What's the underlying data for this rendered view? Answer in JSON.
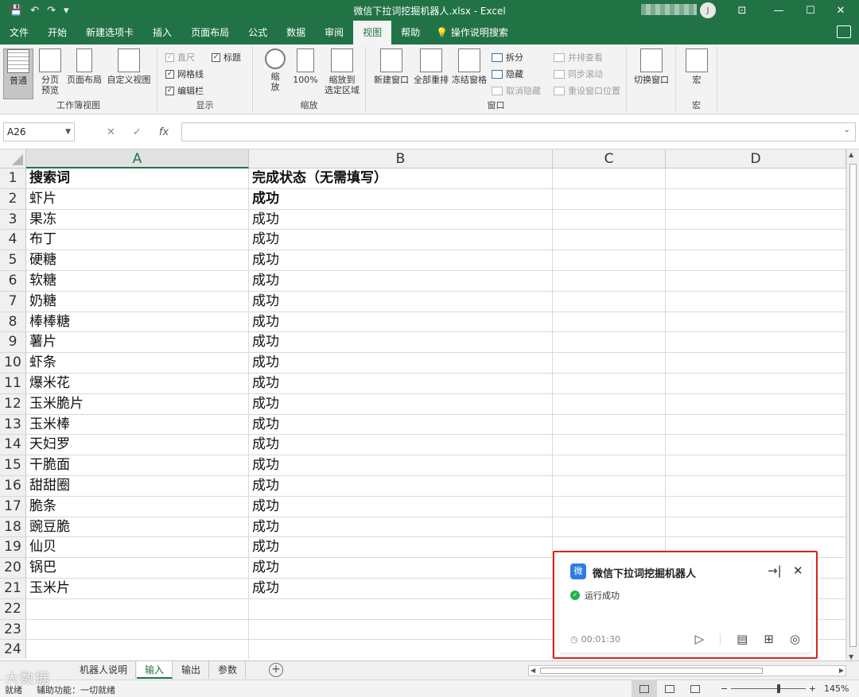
{
  "window": {
    "title": "微信下拉词挖掘机器人.xlsx  -  Excel",
    "user_initial": "J",
    "qa_save": "💾",
    "qa_undo": "↶",
    "qa_redo": "↷",
    "qa_more": "▾",
    "ribbon_display": "⊡",
    "minimize": "—",
    "maximize": "☐",
    "close": "✕"
  },
  "tabs": [
    {
      "label": "文件"
    },
    {
      "label": "开始"
    },
    {
      "label": "新建选项卡"
    },
    {
      "label": "插入"
    },
    {
      "label": "页面布局"
    },
    {
      "label": "公式"
    },
    {
      "label": "数据"
    },
    {
      "label": "审阅"
    },
    {
      "label": "视图"
    },
    {
      "label": "帮助"
    }
  ],
  "tell_me": "操作说明搜索",
  "ribbon": {
    "groups": {
      "workbook_views": "工作簿视图",
      "show": "显示",
      "zoom": "缩放",
      "window": "窗口",
      "macros": "宏"
    },
    "normal": "普通",
    "page_break": "分页\n预览",
    "page_layout": "页面布局",
    "custom_views": "自定义视图",
    "ruler": "直尺",
    "gridlines": "网格线",
    "formula_bar": "编辑栏",
    "headings": "标题",
    "check_mark": "✓",
    "zoom": "缩\n放",
    "zoom_100": "100%",
    "zoom_selection": "缩放到\n选定区域",
    "new_window": "新建窗口",
    "arrange_all": "全部重排",
    "freeze_panes": "冻结窗格",
    "split": "拆分",
    "hide": "隐藏",
    "unhide": "取消隐藏",
    "side_by_side": "并排查看",
    "sync_scroll": "同步滚动",
    "reset_pos": "重设窗口位置",
    "switch_windows": "切换窗口",
    "macros": "宏"
  },
  "formula_bar": {
    "name_box": "A26",
    "cancel": "✕",
    "enter": "✓",
    "fx": "fx",
    "value": ""
  },
  "columns": [
    "A",
    "B",
    "C",
    "D"
  ],
  "rows": [
    {
      "n": "1",
      "a": "搜索词",
      "b": "完成状态（无需填写）"
    },
    {
      "n": "2",
      "a": "虾片",
      "b": "成功"
    },
    {
      "n": "3",
      "a": "果冻",
      "b": "成功"
    },
    {
      "n": "4",
      "a": "布丁",
      "b": "成功"
    },
    {
      "n": "5",
      "a": "硬糖",
      "b": "成功"
    },
    {
      "n": "6",
      "a": "软糖",
      "b": "成功"
    },
    {
      "n": "7",
      "a": "奶糖",
      "b": "成功"
    },
    {
      "n": "8",
      "a": "棒棒糖",
      "b": "成功"
    },
    {
      "n": "9",
      "a": "薯片",
      "b": "成功"
    },
    {
      "n": "10",
      "a": "虾条",
      "b": "成功"
    },
    {
      "n": "11",
      "a": "爆米花",
      "b": "成功"
    },
    {
      "n": "12",
      "a": "玉米脆片",
      "b": "成功"
    },
    {
      "n": "13",
      "a": "玉米棒",
      "b": "成功"
    },
    {
      "n": "14",
      "a": "天妇罗",
      "b": "成功"
    },
    {
      "n": "15",
      "a": "干脆面",
      "b": "成功"
    },
    {
      "n": "16",
      "a": "甜甜圈",
      "b": "成功"
    },
    {
      "n": "17",
      "a": "脆条",
      "b": "成功"
    },
    {
      "n": "18",
      "a": "豌豆脆",
      "b": "成功"
    },
    {
      "n": "19",
      "a": "仙贝",
      "b": "成功"
    },
    {
      "n": "20",
      "a": "锅巴",
      "b": "成功"
    },
    {
      "n": "21",
      "a": "玉米片",
      "b": "成功"
    },
    {
      "n": "22",
      "a": "",
      "b": ""
    },
    {
      "n": "23",
      "a": "",
      "b": ""
    },
    {
      "n": "24",
      "a": "",
      "b": ""
    }
  ],
  "sheets": [
    {
      "label": "机器人说明"
    },
    {
      "label": "输入"
    },
    {
      "label": "输出"
    },
    {
      "label": "参数"
    }
  ],
  "add_sheet": "+",
  "statusbar": {
    "ready": "就绪",
    "accessibility": "辅助功能：一切就绪",
    "zoom_pct": "145%",
    "zoom_minus": "−",
    "zoom_plus": "+"
  },
  "watermark": "大数据",
  "popup": {
    "app_icon": "微",
    "title": "微信下拉词挖掘机器人",
    "pin": "→|",
    "close": "✕",
    "status": "运行成功",
    "status_check": "✓",
    "time": "00:01:30",
    "clock": "◷",
    "run": "▷",
    "log": "▤",
    "table": "⊞",
    "extra": "◎"
  }
}
